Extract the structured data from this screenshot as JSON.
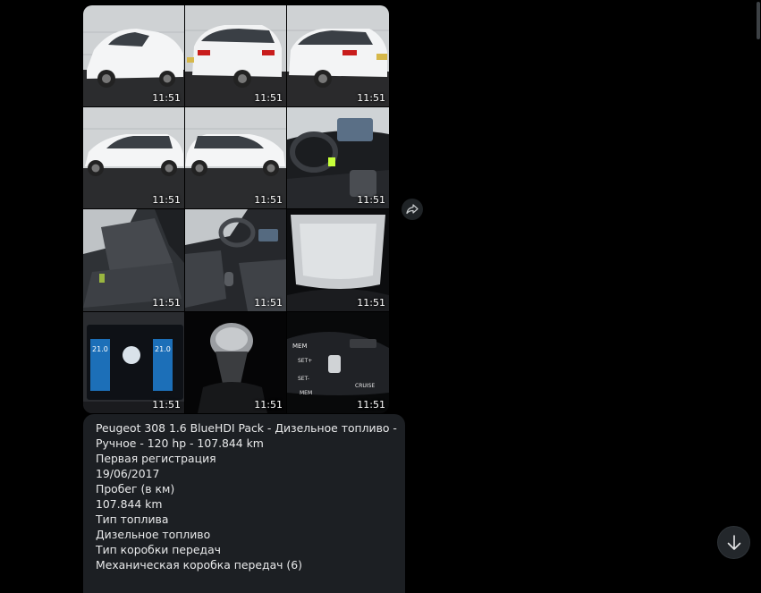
{
  "album": {
    "photos": [
      {
        "subject": "car-front-left",
        "time": "11:51"
      },
      {
        "subject": "car-rear",
        "time": "11:51"
      },
      {
        "subject": "car-rear-right",
        "time": "11:51"
      },
      {
        "subject": "car-side-left",
        "time": "11:51"
      },
      {
        "subject": "car-side-right",
        "time": "11:51"
      },
      {
        "subject": "dashboard",
        "time": "11:51"
      },
      {
        "subject": "rear-seats",
        "time": "11:51"
      },
      {
        "subject": "front-interior",
        "time": "11:51"
      },
      {
        "subject": "panoramic-roof",
        "time": "11:51"
      },
      {
        "subject": "climate-display",
        "time": "11:51"
      },
      {
        "subject": "gear-knob",
        "time": "11:51"
      },
      {
        "subject": "cruise-control-stalk",
        "time": "11:51"
      }
    ]
  },
  "share_icon": "share-arrow-icon",
  "message": {
    "lines": [
      "Peugeot 308 1.6 BlueHDI Pack - Дизельное топливо -",
      "Ручное - 120 hp - 107.844 km",
      "Первая регистрация",
      "19/06/2017",
      "Пробег (в км)",
      "107.844 km",
      "Тип топлива",
      "Дизельное топливо",
      "Тип коробки передач",
      "Механическая коробка передач (6)"
    ]
  },
  "scroll_down_icon": "arrow-down-icon",
  "colors": {
    "background": "#000000",
    "bubble": "#1c1f23",
    "text": "#e9eaeb"
  }
}
